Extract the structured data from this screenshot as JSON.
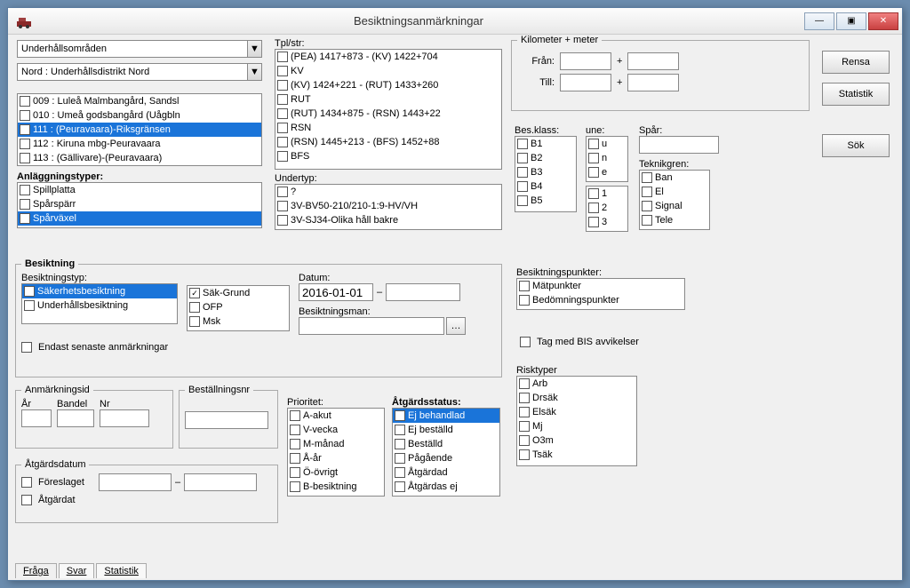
{
  "window": {
    "title": "Besiktningsanmärkningar"
  },
  "win_controls": {
    "min": "—",
    "max": "▣",
    "close": "✕"
  },
  "top_combos": {
    "area": "Underhållsområden",
    "district": "Nord : Underhållsdistrikt Nord"
  },
  "bandelar": {
    "items": [
      {
        "checked": false,
        "label": "009 : Luleå Malmbangård,  Sandsl"
      },
      {
        "checked": false,
        "label": "010 : Umeå godsbangård (Uågbln"
      },
      {
        "checked": true,
        "label": "111 : (Peuravaara)-Riksgränsen",
        "selected": true
      },
      {
        "checked": false,
        "label": "112 : Kiruna mbg-Peuravaara"
      },
      {
        "checked": false,
        "label": "113 : (Gällivare)-(Peuravaara)"
      }
    ]
  },
  "anlaggning": {
    "label": "Anläggningstyper:",
    "items": [
      {
        "checked": false,
        "label": "Spillplatta"
      },
      {
        "checked": false,
        "label": "Spårspärr"
      },
      {
        "checked": true,
        "label": "Spårväxel",
        "selected": true
      }
    ]
  },
  "tplstr": {
    "label": "Tpl/str:",
    "items": [
      {
        "checked": false,
        "label": "(PEA) 1417+873 - (KV) 1422+704"
      },
      {
        "checked": false,
        "label": "KV"
      },
      {
        "checked": false,
        "label": "(KV) 1424+221 - (RUT) 1433+260"
      },
      {
        "checked": false,
        "label": "RUT"
      },
      {
        "checked": false,
        "label": "(RUT) 1434+875 - (RSN) 1443+22"
      },
      {
        "checked": false,
        "label": "RSN"
      },
      {
        "checked": false,
        "label": "(RSN) 1445+213 - (BFS) 1452+88"
      },
      {
        "checked": false,
        "label": "BFS"
      }
    ]
  },
  "undertyp": {
    "label": "Undertyp:",
    "items": [
      {
        "checked": false,
        "label": "?"
      },
      {
        "checked": false,
        "label": "3V-BV50-210/210-1:9-HV/VH"
      },
      {
        "checked": false,
        "label": "3V-SJ34-Olika håll bakre"
      }
    ]
  },
  "km": {
    "legend": "Kilometer + meter",
    "fran_label": "Från:",
    "till_label": "Till:",
    "plus": "+"
  },
  "besklass": {
    "label": "Bes.klass:",
    "items": [
      "B1",
      "B2",
      "B3",
      "B4",
      "B5"
    ]
  },
  "une": {
    "label": "une:",
    "group1": [
      "u",
      "n",
      "e"
    ],
    "group2": [
      "1",
      "2",
      "3"
    ]
  },
  "spar": {
    "label": "Spår:"
  },
  "teknikgren": {
    "label": "Teknikgren:",
    "items": [
      "Ban",
      "El",
      "Signal",
      "Tele"
    ]
  },
  "buttons": {
    "rensa": "Rensa",
    "statistik": "Statistik",
    "sok": "Sök"
  },
  "besiktning": {
    "legend": "Besiktning",
    "typ_label": "Besiktningstyp:",
    "typer": [
      {
        "checked": true,
        "label": "Säkerhetsbesiktning",
        "selected": true
      },
      {
        "checked": false,
        "label": "Underhållsbesiktning"
      }
    ],
    "sub": [
      {
        "checked": true,
        "label": "Säk-Grund"
      },
      {
        "checked": false,
        "label": "OFP"
      },
      {
        "checked": false,
        "label": "Msk"
      }
    ],
    "datum_label": "Datum:",
    "datum_from": "2016-01-01",
    "datum_sep": "–",
    "man_label": "Besiktningsman:",
    "endast": "Endast senaste anmärkningar"
  },
  "besiktpunkter": {
    "label": "Besiktningspunkter:",
    "items": [
      "Mätpunkter",
      "Bedömningspunkter"
    ]
  },
  "bis": "Tag med BIS avvikelser",
  "risktyper": {
    "label": "Risktyper",
    "items": [
      "Arb",
      "Drsäk",
      "Elsäk",
      "Mj",
      "O3m",
      "Tsäk"
    ]
  },
  "anmid": {
    "legend": "Anmärkningsid",
    "ar": "År",
    "bandel": "Bandel",
    "nr": "Nr"
  },
  "bestall": {
    "legend": "Beställningsnr"
  },
  "prioritet": {
    "label": "Prioritet:",
    "items": [
      "A-akut",
      "V-vecka",
      "M-månad",
      "Å-år",
      "Ö-övrigt",
      "B-besiktning"
    ]
  },
  "atgardsstatus": {
    "label": "Åtgärdsstatus:",
    "items": [
      {
        "checked": true,
        "label": "Ej behandlad",
        "selected": true
      },
      {
        "checked": false,
        "label": "Ej beställd"
      },
      {
        "checked": false,
        "label": "Beställd"
      },
      {
        "checked": false,
        "label": "Pågående"
      },
      {
        "checked": false,
        "label": "Åtgärdad"
      },
      {
        "checked": false,
        "label": "Åtgärdas ej"
      }
    ]
  },
  "atgardsdatum": {
    "legend": "Åtgärdsdatum",
    "foreslagt": "Föreslaget",
    "atgardat": "Åtgärdat",
    "sep": "–"
  },
  "tabs": {
    "fraga": "Fråga",
    "svar": "Svar",
    "statistik": "Statistik"
  }
}
